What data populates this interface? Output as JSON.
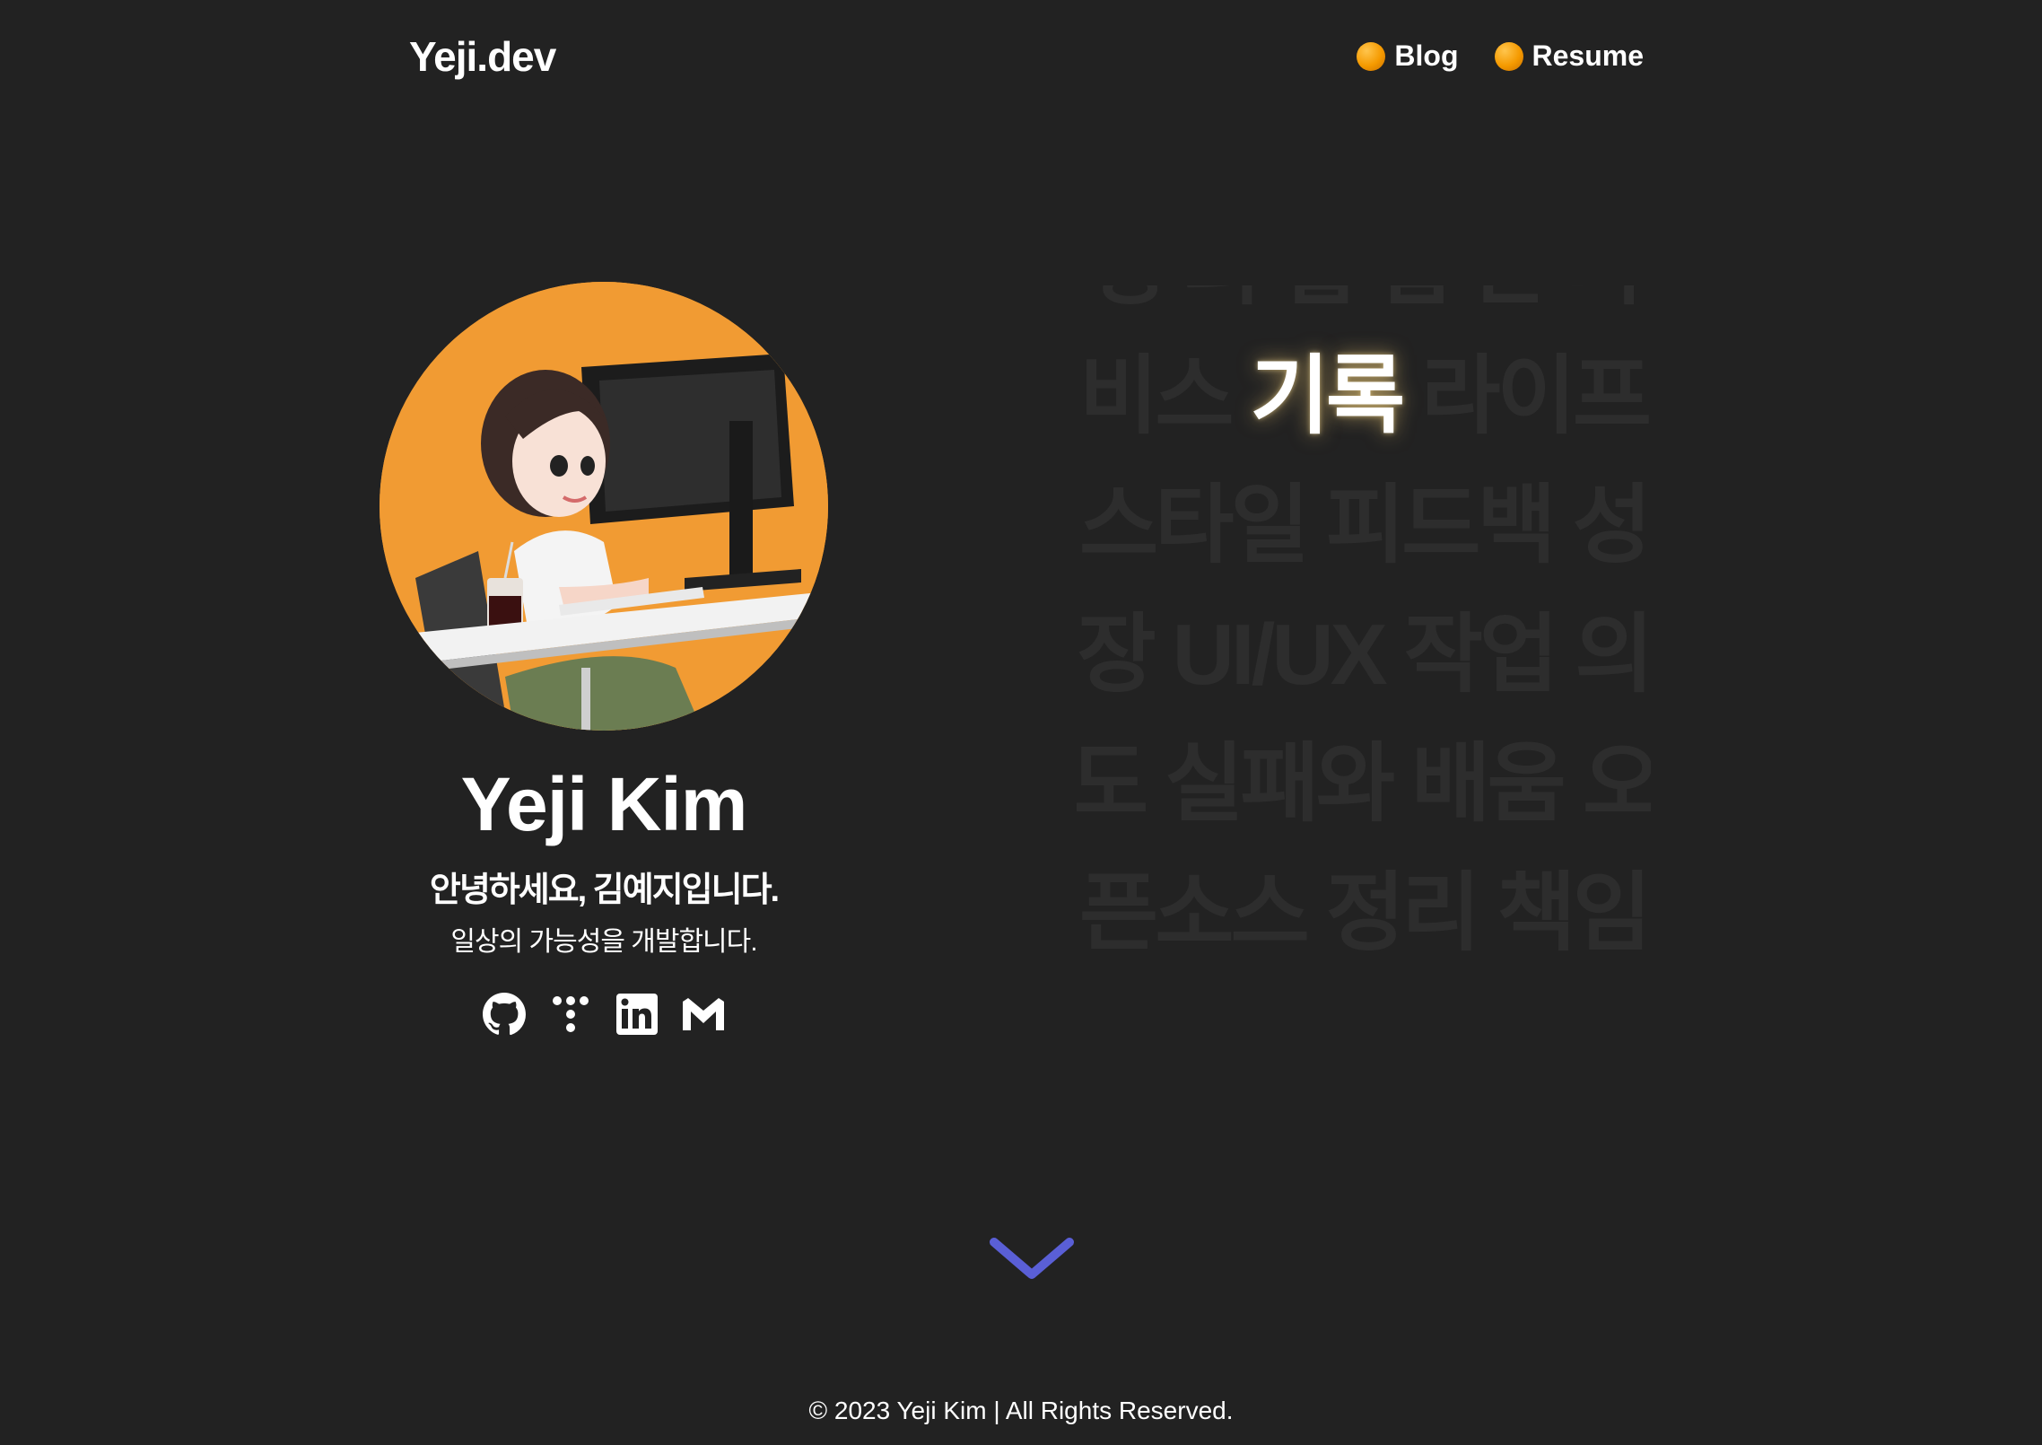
{
  "header": {
    "logo": "Yeji.dev",
    "nav": [
      {
        "label": "Blog"
      },
      {
        "label": "Resume"
      }
    ]
  },
  "profile": {
    "name": "Yeji Kim",
    "greeting": "안녕하세요, 김예지입니다.",
    "tagline": "일상의 가능성을 개발합니다.",
    "socials": [
      {
        "icon": "github-icon"
      },
      {
        "icon": "tistory-icon"
      },
      {
        "icon": "linkedin-icon"
      },
      {
        "icon": "gmail-icon"
      }
    ]
  },
  "word_grid": {
    "rows": [
      [
        "열",
        "정",
        "의",
        "협",
        "업",
        "관",
        "리",
        "지"
      ],
      [
        "비스",
        "기록",
        "라이프"
      ],
      [
        "스타일",
        "피드백",
        "성"
      ],
      [
        "장",
        "UI/UX",
        "작업",
        "의"
      ],
      [
        "도",
        "실패와",
        "배움",
        "오"
      ],
      [
        "픈소스",
        "정리",
        "책임"
      ]
    ],
    "active_word": "기록"
  },
  "footer": {
    "copyright": "© 2023 Yeji Kim | All Rights Reserved."
  },
  "colors": {
    "background": "#222222",
    "accent_orange": "#f19b33",
    "chevron": "#5a5fd6",
    "dim_text": "#2d2d2d"
  }
}
